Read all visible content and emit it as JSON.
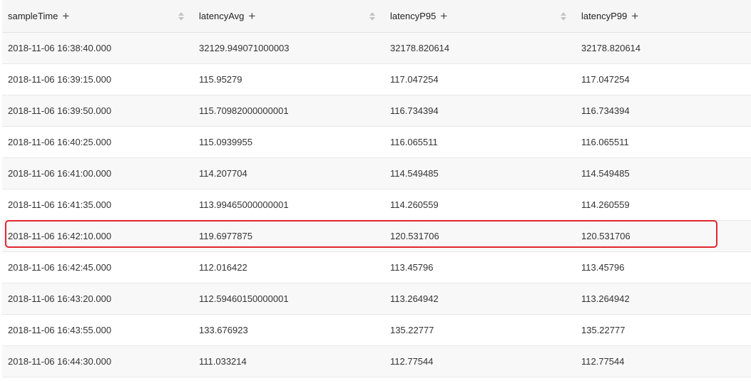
{
  "table": {
    "columns": [
      {
        "label": "sampleTime",
        "add_icon": "plus-icon",
        "sort_icon": "sort-icon"
      },
      {
        "label": "latencyAvg",
        "add_icon": "plus-icon",
        "sort_icon": "sort-icon"
      },
      {
        "label": "latencyP95",
        "add_icon": "plus-icon",
        "sort_icon": "sort-icon"
      },
      {
        "label": "latencyP99",
        "add_icon": "plus-icon"
      }
    ],
    "rows": [
      [
        "2018-11-06 16:38:40.000",
        "32129.949071000003",
        "32178.820614",
        "32178.820614"
      ],
      [
        "2018-11-06 16:39:15.000",
        "115.95279",
        "117.047254",
        "117.047254"
      ],
      [
        "2018-11-06 16:39:50.000",
        "115.70982000000001",
        "116.734394",
        "116.734394"
      ],
      [
        "2018-11-06 16:40:25.000",
        "115.0939955",
        "116.065511",
        "116.065511"
      ],
      [
        "2018-11-06 16:41:00.000",
        "114.207704",
        "114.549485",
        "114.549485"
      ],
      [
        "2018-11-06 16:41:35.000",
        "113.99465000000001",
        "114.260559",
        "114.260559"
      ],
      [
        "2018-11-06 16:42:10.000",
        "119.6977875",
        "120.531706",
        "120.531706"
      ],
      [
        "2018-11-06 16:42:45.000",
        "112.016422",
        "113.45796",
        "113.45796"
      ],
      [
        "2018-11-06 16:43:20.000",
        "112.59460150000001",
        "113.264942",
        "113.264942"
      ],
      [
        "2018-11-06 16:43:55.000",
        "133.676923",
        "135.22777",
        "135.22777"
      ],
      [
        "2018-11-06 16:44:30.000",
        "111.033214",
        "112.77544",
        "112.77544"
      ]
    ],
    "highlighted_row_index": 6
  },
  "colors": {
    "highlight": "#e0282e",
    "header_bg": "#f6f6f6",
    "alt_row_bg": "#f8f8f8"
  }
}
